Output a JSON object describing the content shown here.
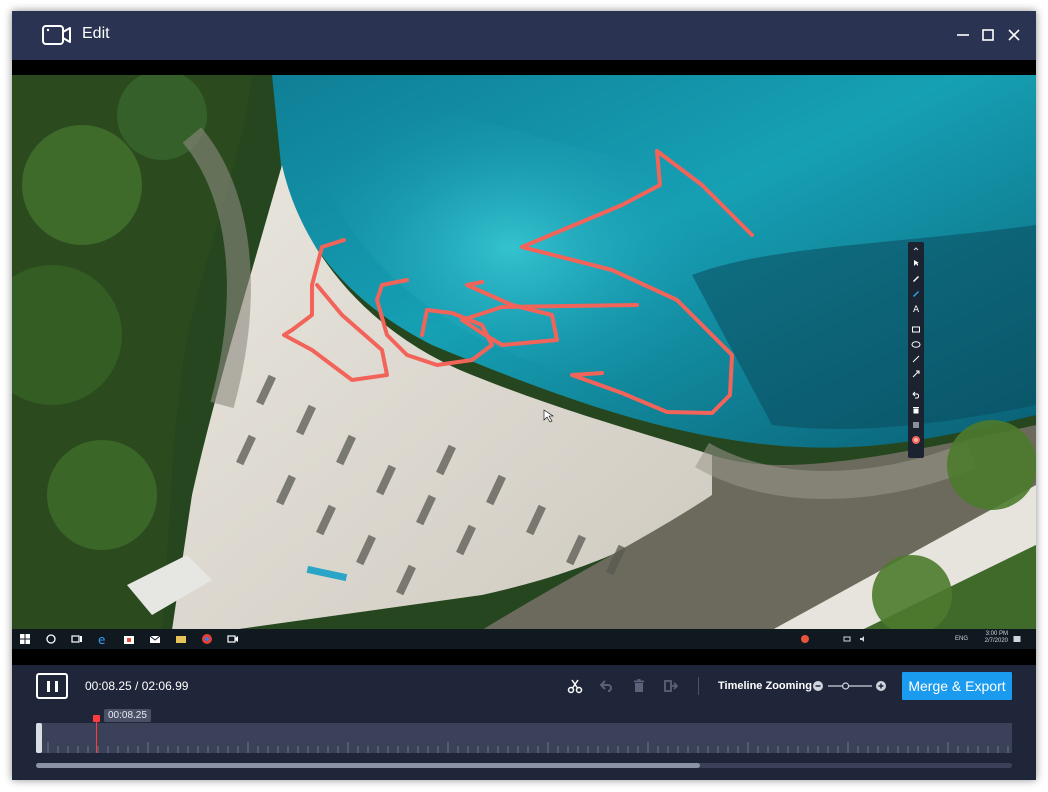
{
  "window": {
    "title": "Edit"
  },
  "taskbar": {
    "lang": "ENG",
    "clock_time": "3:00 PM",
    "clock_date": "2/7/2020"
  },
  "drawing_tools": [
    "collapse",
    "cursor",
    "pen",
    "marker",
    "text",
    "rectangle",
    "ellipse",
    "line",
    "arrow",
    "undo",
    "delete",
    "menu",
    "record"
  ],
  "controls": {
    "current_time": "00:08.25",
    "separator": " / ",
    "total_time": "02:06.99",
    "zoom_label": "Timeline Zooming",
    "merge_export_label": "Merge & Export",
    "zoom_level": 0.4
  },
  "timeline": {
    "playhead_label": "00:08.25",
    "playhead_fraction": 0.065,
    "scroll_fraction": 0.68
  },
  "colors": {
    "accent": "#1a9bf0",
    "playhead": "#ff3b3b",
    "annotation": "#f2645a"
  }
}
